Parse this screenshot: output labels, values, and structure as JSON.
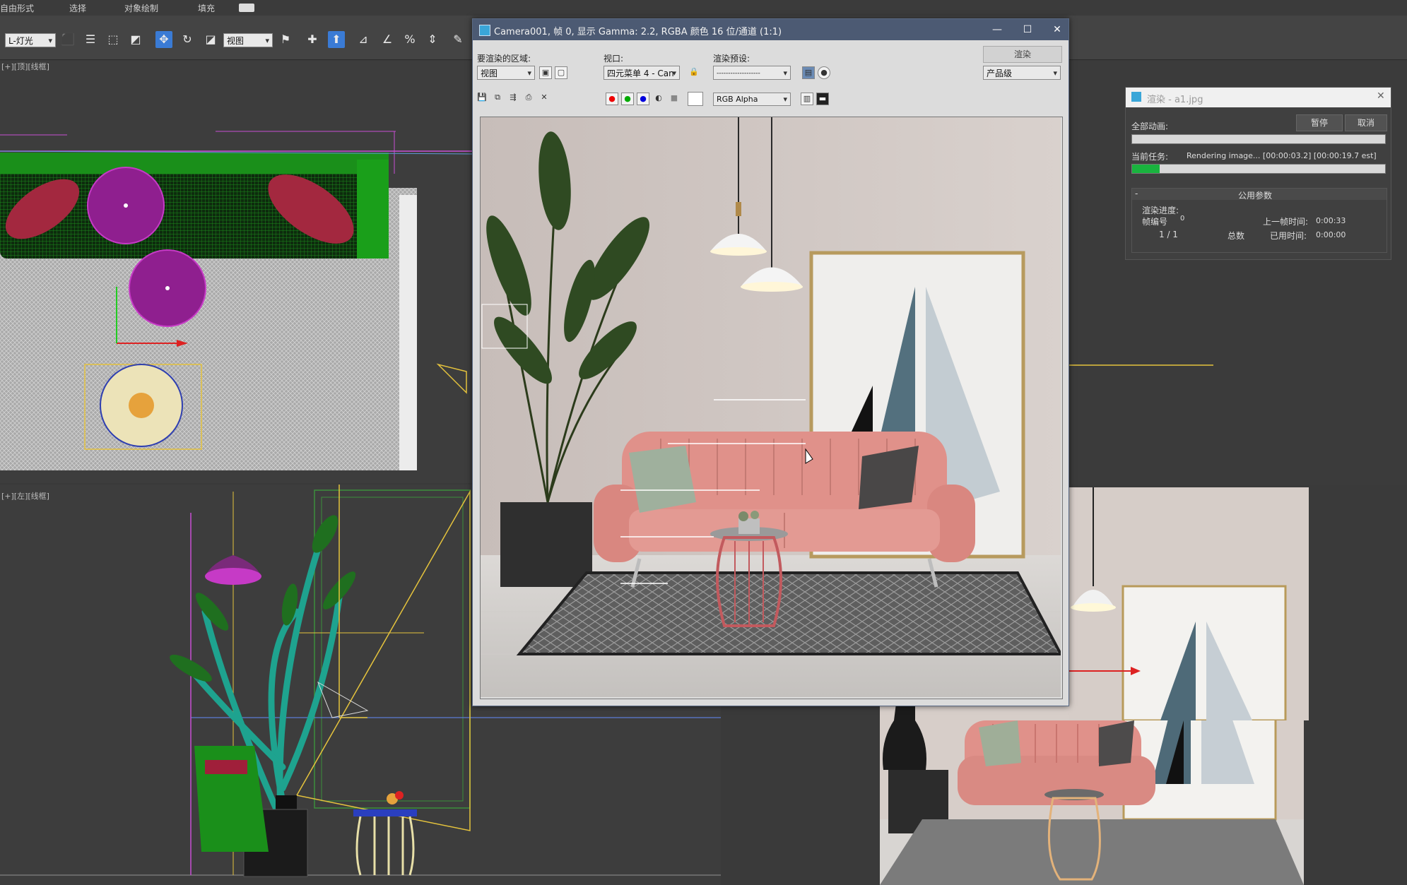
{
  "menubar": {
    "items": [
      "自由形式",
      "选择",
      "对象绘制",
      "填充"
    ]
  },
  "toolbar": {
    "layer_select": "L-灯光",
    "coord_select": "视图"
  },
  "viewports": {
    "top_left_label": "[+][顶][线框]",
    "bottom_left_label": "[+][左][线框]"
  },
  "frame_window": {
    "title": "Camera001, 帧 0, 显示 Gamma: 2.2, RGBA 颜色 16 位/通道 (1:1)",
    "area_label": "要渲染的区域:",
    "area_value": "视图",
    "viewport_label": "视口:",
    "viewport_value": "四元菜单 4 - Can",
    "preset_label": "渲染预设:",
    "preset_value": "-------------------",
    "render_button": "渲染",
    "quality_value": "产品级",
    "channel_value": "RGB Alpha",
    "controls": {
      "minimize": "—",
      "maximize": "☐",
      "close": "✕"
    }
  },
  "progress_window": {
    "title": "渲染 - a1.jpg",
    "all_animation_label": "全部动画:",
    "pause_button": "暂停",
    "cancel_button": "取消",
    "current_task_label": "当前任务:",
    "current_task_text": "Rendering image... [00:00:03.2] [00:00:19.7 est]",
    "current_progress": 0.11,
    "all_progress": 0.0,
    "params_header": "公用参数",
    "render_progress_label": "渲染进度:",
    "frame_no_label": "帧编号",
    "frame_no_value": "0",
    "frame_count": "1 / 1",
    "total_label": "总数",
    "last_frame_time_label": "上一帧时间:",
    "last_frame_time_value": "0:00:33",
    "elapsed_label": "已用时间:",
    "elapsed_value": "0:00:00"
  },
  "icons": [
    "move-icon",
    "rotate-icon",
    "scale-icon",
    "snap-icon",
    "select-icon",
    "lock-icon",
    "render-icon"
  ],
  "colors": {
    "accent_blue": "#3a7bd5",
    "progress_green": "#19b33e",
    "sofa_pink": "#e0918a",
    "wire_green": "#1c8a1c",
    "wire_magenta": "#a0228a"
  }
}
